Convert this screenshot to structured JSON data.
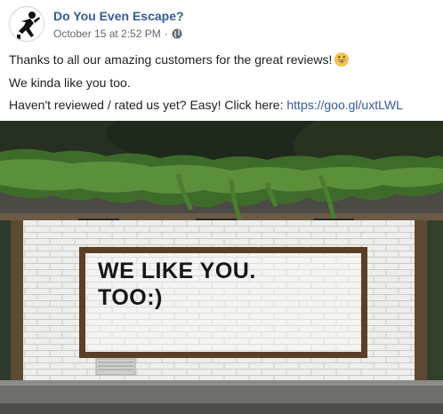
{
  "post": {
    "page_name": "Do You Even Escape?",
    "timestamp": "October 15 at 2:52 PM",
    "separator": "·",
    "privacy_icon": "globe-icon",
    "avatar_icon": "running-figure-icon"
  },
  "body": {
    "line1": "Thanks to all our amazing customers for the great reviews!",
    "line1_emoji": "grinning-face-emoji",
    "line2": "We kinda like you too.",
    "line3_text": "Haven't reviewed / rated us yet? Easy! Click here: ",
    "line3_link": "https://goo.gl/uxtLWL"
  },
  "photo": {
    "sign_line1": "WE LIKE YOU.",
    "sign_line2": "TOO:)"
  },
  "colors": {
    "link": "#385898",
    "text": "#1c1e21",
    "meta": "#616770"
  }
}
